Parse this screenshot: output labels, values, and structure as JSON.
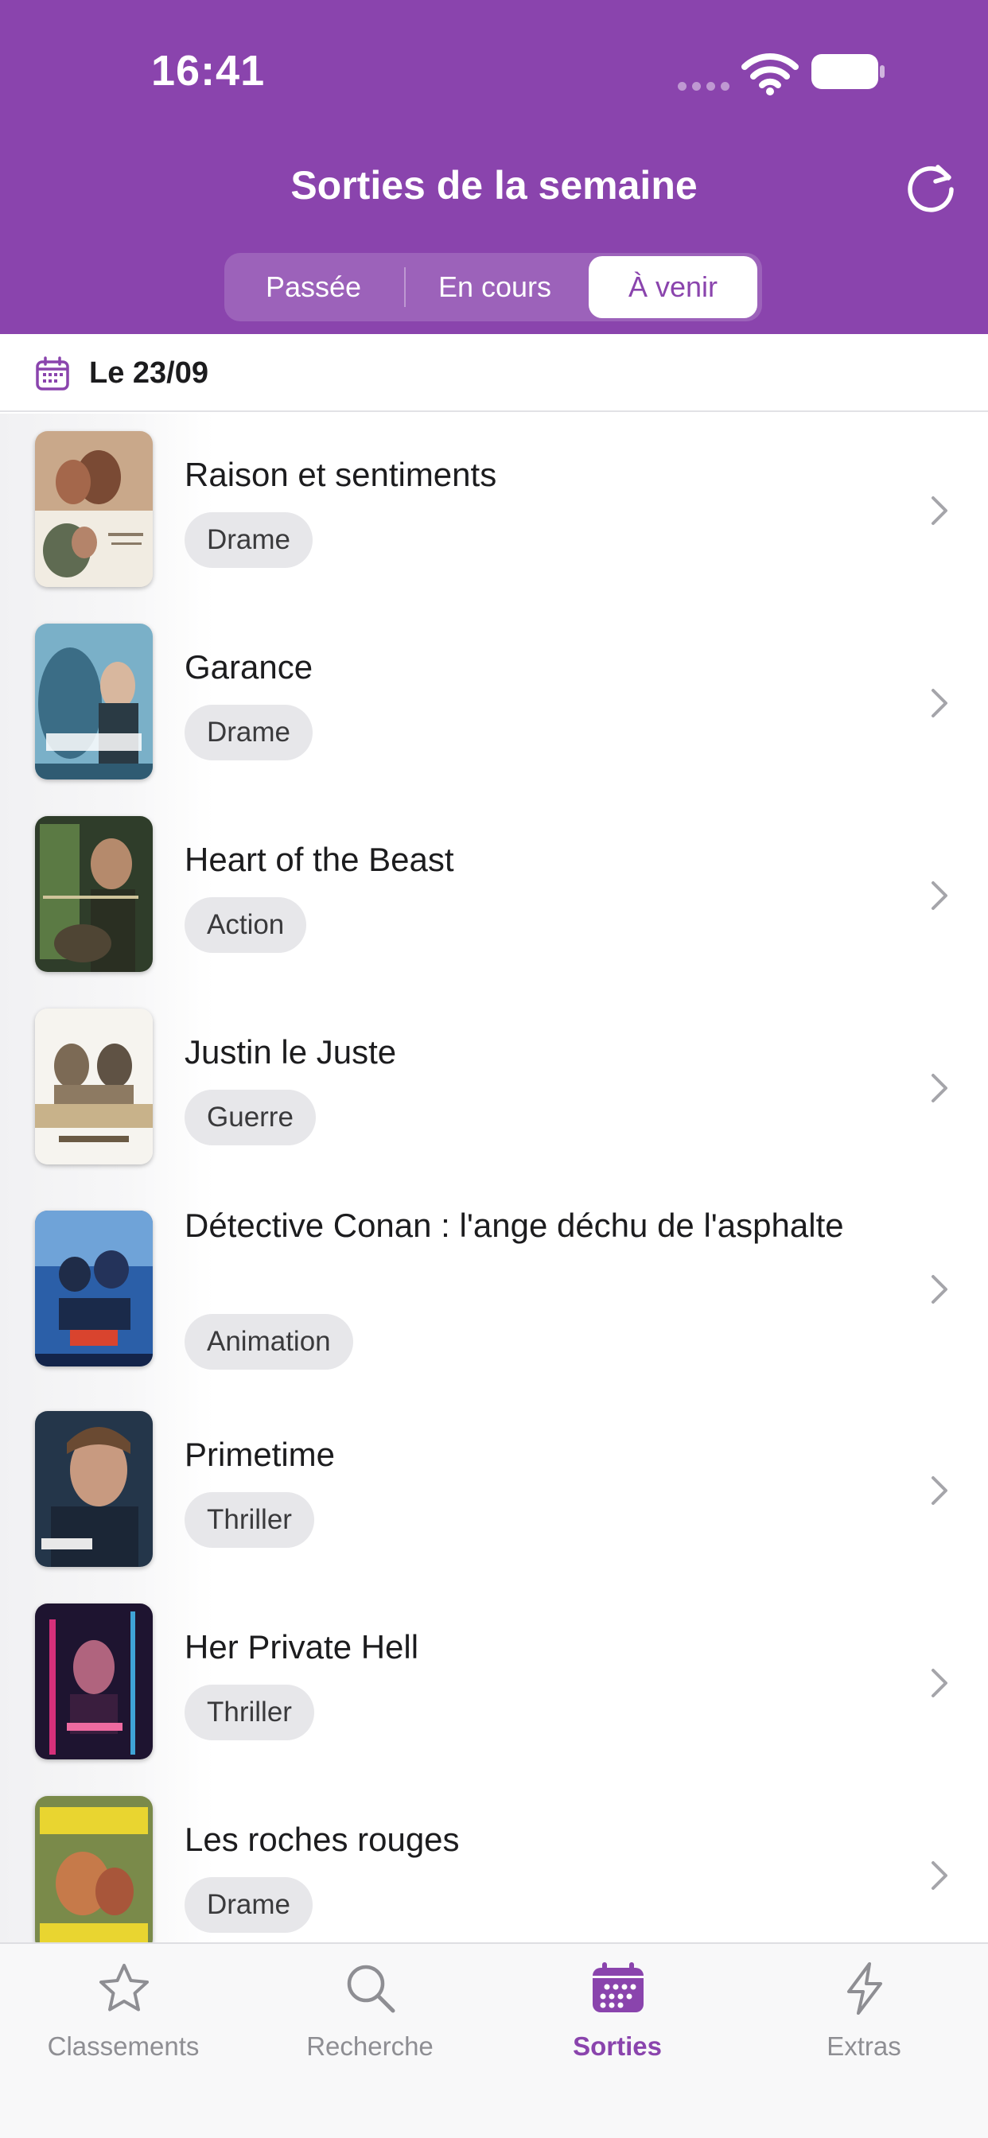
{
  "status_bar": {
    "time": "16:41"
  },
  "header": {
    "title": "Sorties de la semaine",
    "refresh_icon": "refresh-icon",
    "accent_color": "#8a44ad"
  },
  "segments": [
    {
      "label": "Passée",
      "selected": false
    },
    {
      "label": "En cours",
      "selected": false
    },
    {
      "label": "À venir",
      "selected": true
    }
  ],
  "date_section": {
    "label": "Le 23/09",
    "icon": "calendar-icon"
  },
  "movies": [
    {
      "title": "Raison et sentiments",
      "genre": "Drame"
    },
    {
      "title": "Garance",
      "genre": "Drame"
    },
    {
      "title": "Heart of the Beast",
      "genre": "Action"
    },
    {
      "title": "Justin le Juste",
      "genre": "Guerre"
    },
    {
      "title": "Détective Conan : l'ange déchu de l'asphalte",
      "genre": "Animation"
    },
    {
      "title": "Primetime",
      "genre": "Thriller"
    },
    {
      "title": "Her Private Hell",
      "genre": "Thriller"
    },
    {
      "title": "Les roches rouges",
      "genre": "Drame"
    }
  ],
  "tabbar": {
    "items": [
      {
        "label": "Classements",
        "icon": "star-icon",
        "active": false
      },
      {
        "label": "Recherche",
        "icon": "search-icon",
        "active": false
      },
      {
        "label": "Sorties",
        "icon": "calendar-icon",
        "active": true
      },
      {
        "label": "Extras",
        "icon": "bolt-icon",
        "active": false
      }
    ]
  }
}
